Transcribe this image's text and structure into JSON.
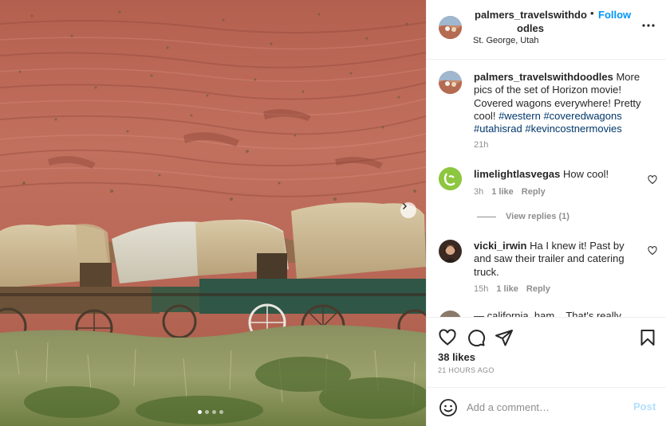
{
  "post": {
    "username_display_line1": "palmers_travelswithdo",
    "username_display_line2": "odles",
    "follow_separator": "•",
    "follow_label": "Follow",
    "location": "St. George, Utah",
    "more_icon": "more-horizontal-icon"
  },
  "caption": {
    "username": "palmers_travelswithdoodles",
    "text": " More pics of the set of Horizon movie! Covered wagons everywhere! Pretty cool! ",
    "hashtags": [
      "#western",
      "#coveredwagons",
      "#utahisrad",
      "#kevincostnermovies"
    ],
    "time": "21h"
  },
  "comments": [
    {
      "username": "limelightlasvegas",
      "text": " How cool!",
      "time": "3h",
      "likes": "1 like",
      "reply": "Reply",
      "avatar_color": "#8dc63f"
    },
    {
      "username": "vicki_irwin",
      "text": " Ha I knew it! Past by and saw their trailer and catering truck.",
      "time": "15h",
      "likes": "1 like",
      "reply": "Reply",
      "avatar_color": "#3a2a22"
    }
  ],
  "view_replies": "View replies (1)",
  "truncated_comment": "— california_ham... That's really",
  "likes": "38 likes",
  "post_time": "21 HOURS AGO",
  "add_comment": {
    "placeholder": "Add a comment…",
    "post_label": "Post"
  },
  "carousel": {
    "total": 4,
    "active": 1
  },
  "colors": {
    "accent": "#0095f6",
    "hashtag": "#00376b",
    "muted": "#8e8e8e",
    "post_disabled": "#b2dffc"
  }
}
